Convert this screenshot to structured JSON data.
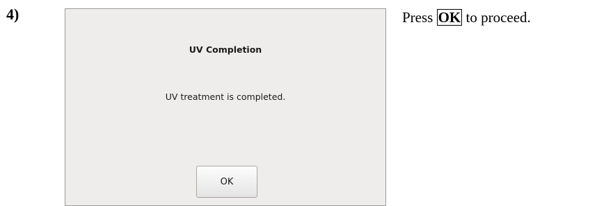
{
  "step": {
    "number": "4)"
  },
  "dialog": {
    "title": "UV Completion",
    "message": "UV treatment is completed.",
    "ok_label": "OK"
  },
  "instruction": {
    "prefix": "Press ",
    "key": "OK",
    "suffix": " to proceed."
  }
}
